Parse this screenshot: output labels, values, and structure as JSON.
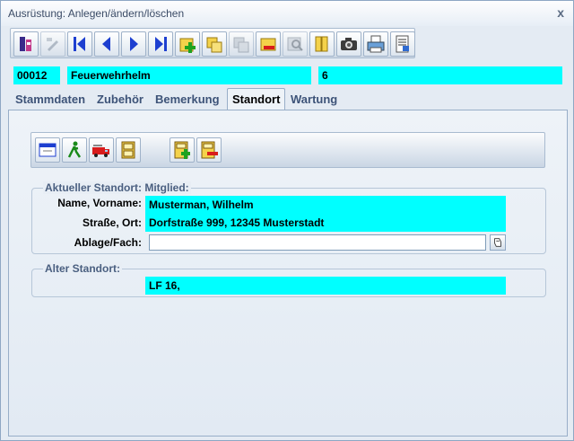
{
  "window": {
    "title": "Ausrüstung: Anlegen/ändern/löschen",
    "close_label": "x"
  },
  "toolbar": {
    "buttons": [
      {
        "icon": "exit-icon"
      },
      {
        "icon": "edit-icon"
      },
      {
        "icon": "first-record-icon"
      },
      {
        "icon": "previous-record-icon"
      },
      {
        "icon": "next-record-icon"
      },
      {
        "icon": "last-record-icon"
      },
      {
        "icon": "add-record-icon"
      },
      {
        "icon": "copy-record-icon"
      },
      {
        "icon": "duplicate-icon"
      },
      {
        "icon": "delete-record-icon"
      },
      {
        "icon": "search-icon"
      },
      {
        "icon": "binder-icon"
      },
      {
        "icon": "camera-icon"
      },
      {
        "icon": "print-icon"
      },
      {
        "icon": "report-icon"
      }
    ]
  },
  "record": {
    "id": "00012",
    "name": "Feuerwehrhelm",
    "count": "6"
  },
  "tabs": [
    "Stammdaten",
    "Zubehör",
    "Bemerkung",
    "Standort",
    "Wartung"
  ],
  "active_tab": "Standort",
  "standort": {
    "current_group_title": "Aktueller Standort: Mitglied:",
    "name_label": "Name, Vorname:",
    "name_value": "Musterman, Wilhelm",
    "street_label": "Straße, Ort:",
    "street_value": "Dorfstraße 999, 12345 Musterstadt",
    "storage_label": "Ablage/Fach:",
    "storage_value": "",
    "old_group_title": "Alter Standort:",
    "old_value": "LF 16,"
  },
  "colors": {
    "highlight": "#00ffff",
    "panel": "#e4ebf3",
    "accent": "#3d5378"
  }
}
